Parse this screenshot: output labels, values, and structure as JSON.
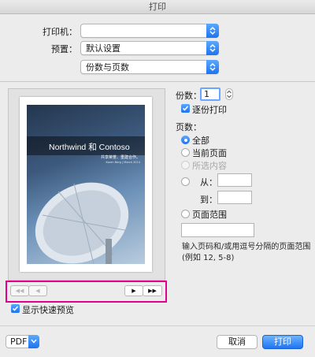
{
  "window": {
    "title": "打印"
  },
  "printer": {
    "label": "打印机：",
    "value": ""
  },
  "presets": {
    "label": "预置：",
    "value": "默认设置"
  },
  "section": {
    "value": "份数与页数"
  },
  "preview": {
    "title": "Northwind 和 Contoso",
    "subtitle": "共享荣誉、重建合作。",
    "byline": "Karen Berg | March 2014",
    "nav": {
      "first": "◀◀",
      "prev": "◀",
      "next": "▶",
      "last": "▶▶"
    },
    "quick_preview_label": "显示快速预览",
    "quick_preview_checked": true
  },
  "copies": {
    "label": "份数：",
    "value": "1",
    "collate_label": "逐份打印",
    "collate_checked": true
  },
  "pages": {
    "label": "页数：",
    "options": {
      "all": "全部",
      "current": "当前页面",
      "selection": "所选内容",
      "from": "从：",
      "to": "到：",
      "range": "页面范围"
    },
    "selected": "all",
    "from_value": "",
    "to_value": "",
    "range_value": "",
    "hint": "输入页码和/或用逗号分隔的页面范围(例如 12, 5-8)"
  },
  "footer": {
    "pdf": "PDF",
    "cancel": "取消",
    "print": "打印"
  },
  "colors": {
    "accent": "#1d73f0",
    "highlight": "#e4008c"
  }
}
